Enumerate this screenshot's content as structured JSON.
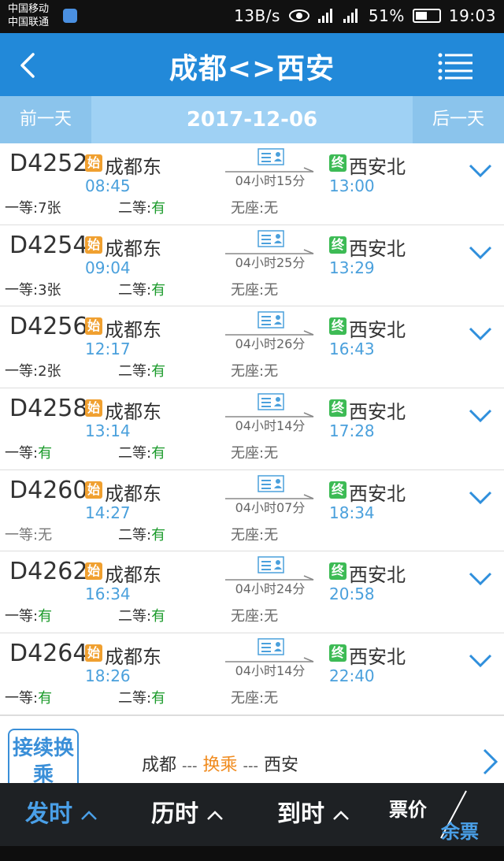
{
  "status_bar": {
    "carrier1": "中国移动",
    "carrier2": "中国联通",
    "net_speed": "13B/s",
    "battery": "51%",
    "time": "19:03"
  },
  "header": {
    "title": "成都<>西安"
  },
  "date_nav": {
    "prev": "前一天",
    "date": "2017-12-06",
    "next": "后一天"
  },
  "labels": {
    "start_badge": "始",
    "end_badge": "终",
    "first_class": "一等:",
    "second_class": "二等:",
    "no_seat": "无座:"
  },
  "trains": [
    {
      "no": "D4252",
      "from": "成都东",
      "to": "西安北",
      "dep": "08:45",
      "arr": "13:00",
      "duration": "04小时15分",
      "first": "7张",
      "second": "有",
      "noseat": "无"
    },
    {
      "no": "D4254",
      "from": "成都东",
      "to": "西安北",
      "dep": "09:04",
      "arr": "13:29",
      "duration": "04小时25分",
      "first": "3张",
      "second": "有",
      "noseat": "无"
    },
    {
      "no": "D4256",
      "from": "成都东",
      "to": "西安北",
      "dep": "12:17",
      "arr": "16:43",
      "duration": "04小时26分",
      "first": "2张",
      "second": "有",
      "noseat": "无"
    },
    {
      "no": "D4258",
      "from": "成都东",
      "to": "西安北",
      "dep": "13:14",
      "arr": "17:28",
      "duration": "04小时14分",
      "first": "有",
      "second": "有",
      "noseat": "无"
    },
    {
      "no": "D4260",
      "from": "成都东",
      "to": "西安北",
      "dep": "14:27",
      "arr": "18:34",
      "duration": "04小时07分",
      "first": "无",
      "second": "有",
      "noseat": "无"
    },
    {
      "no": "D4262",
      "from": "成都东",
      "to": "西安北",
      "dep": "16:34",
      "arr": "20:58",
      "duration": "04小时24分",
      "first": "有",
      "second": "有",
      "noseat": "无"
    },
    {
      "no": "D4264",
      "from": "成都东",
      "to": "西安北",
      "dep": "18:26",
      "arr": "22:40",
      "duration": "04小时14分",
      "first": "有",
      "second": "有",
      "noseat": "无"
    }
  ],
  "transfer": {
    "tag": "接续换乘",
    "from": "成都",
    "mid": "换乘",
    "to": "西安",
    "sep": "---"
  },
  "sort_bar": {
    "departure": "发时",
    "duration": "历时",
    "arrival": "到时",
    "price": "票价",
    "remaining": "余票"
  },
  "colors": {
    "header_blue": "#2289d9",
    "time_blue": "#4aa0dc",
    "available_green": "#1a9a2a",
    "start_orange": "#f0a030",
    "end_green": "#3dbb55",
    "transfer_orange": "#f08a1c"
  }
}
